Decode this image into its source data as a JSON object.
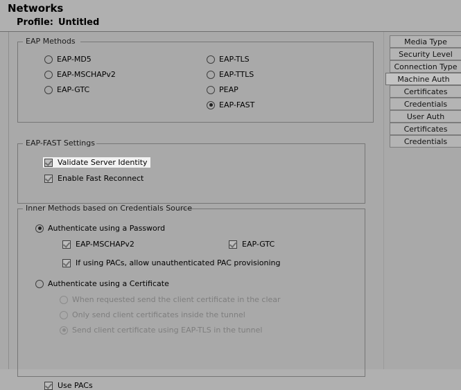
{
  "header": {
    "app_title": "Networks",
    "profile_label": "Profile:",
    "profile_value": "Untitled"
  },
  "eap_methods": {
    "title": "EAP Methods",
    "left_options": [
      {
        "label": "EAP-MD5",
        "checked": false
      },
      {
        "label": "EAP-MSCHAPv2",
        "checked": false
      },
      {
        "label": "EAP-GTC",
        "checked": false
      }
    ],
    "right_options": [
      {
        "label": "EAP-TLS",
        "checked": false
      },
      {
        "label": "EAP-TTLS",
        "checked": false
      },
      {
        "label": "PEAP",
        "checked": false
      },
      {
        "label": "EAP-FAST",
        "checked": true
      }
    ]
  },
  "eap_fast_settings": {
    "title": "EAP-FAST Settings",
    "options": [
      {
        "label": "Validate Server Identity",
        "checked": true,
        "focused": true
      },
      {
        "label": "Enable Fast Reconnect",
        "checked": true,
        "focused": false
      }
    ]
  },
  "inner_methods": {
    "title": "Inner Methods based on Credentials Source",
    "password_option": {
      "label": "Authenticate using a Password",
      "checked": true
    },
    "password_children": [
      {
        "label": "EAP-MSCHAPv2",
        "checked": true
      },
      {
        "label": "EAP-GTC",
        "checked": true
      },
      {
        "label": "If using PACs, allow unauthenticated PAC provisioning",
        "checked": true
      }
    ],
    "certificate_option": {
      "label": "Authenticate using a Certificate",
      "checked": false
    },
    "certificate_children": [
      {
        "label": "When requested send the client certificate in the clear",
        "checked": false,
        "disabled": true
      },
      {
        "label": "Only send client certificates inside the tunnel",
        "checked": false,
        "disabled": true
      },
      {
        "label": "Send client certificate using EAP-TLS in the tunnel",
        "checked": true,
        "disabled": true
      }
    ]
  },
  "use_pacs": {
    "label": "Use PACs",
    "checked": true
  },
  "tabs": [
    {
      "label": "Media Type",
      "selected": false
    },
    {
      "label": "Security Level",
      "selected": false
    },
    {
      "label": "Connection Type",
      "selected": false
    },
    {
      "label": "Machine Auth",
      "selected": true
    },
    {
      "label": "Certificates",
      "selected": false
    },
    {
      "label": "Credentials",
      "selected": false
    },
    {
      "label": "User Auth",
      "selected": false
    },
    {
      "label": "Certificates",
      "selected": false
    },
    {
      "label": "Credentials",
      "selected": false
    }
  ],
  "colors": {
    "window_background": "#b0b0b0",
    "panel_background": "#a9a9a9",
    "border": "#767676",
    "focus_highlight": "#f2f2f2",
    "tab_background": "#b4b4b4",
    "tab_selected_background": "#c3c3c3",
    "disabled_text": "#7e7e7e"
  }
}
